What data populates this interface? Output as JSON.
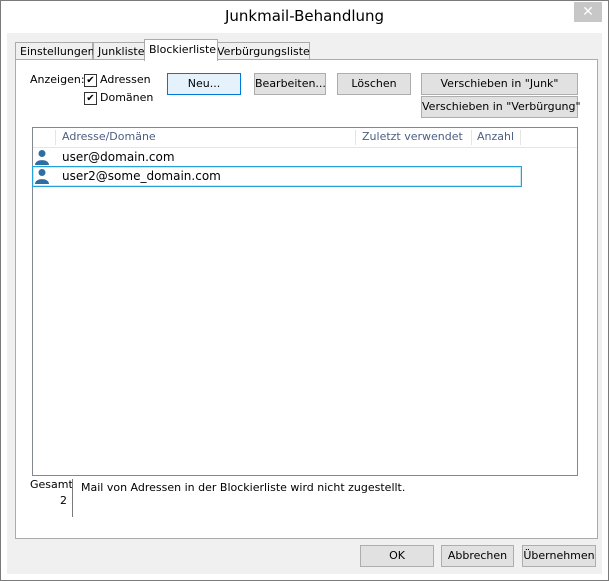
{
  "window": {
    "title": "Junkmail-Behandlung",
    "close_glyph": "✕"
  },
  "tabs": [
    {
      "label": "Einstellungen"
    },
    {
      "label": "Junkliste"
    },
    {
      "label": "Blockierliste"
    },
    {
      "label": "Verbürgungsliste"
    }
  ],
  "filter": {
    "label": "Anzeigen:",
    "options": [
      {
        "label": "Adressen",
        "checked": true
      },
      {
        "label": "Domänen",
        "checked": true
      }
    ]
  },
  "actions": {
    "new": "Neu...",
    "edit": "Bearbeiten...",
    "delete": "Löschen",
    "move_junk": "Verschieben in \"Junk\"",
    "move_trusted": "Verschieben in \"Verbürgung\""
  },
  "list": {
    "columns": [
      "Adresse/Domäne",
      "Zuletzt verwendet",
      "Anzahl"
    ],
    "rows": [
      {
        "address": "user@domain.com",
        "icon": "user-icon",
        "selected": false
      },
      {
        "address": "user2@some_domain.com",
        "icon": "user-icon",
        "selected": true
      }
    ]
  },
  "summary": {
    "total_label": "Gesamt",
    "total_value": "2",
    "note": "Mail von Adressen in der Blockierliste wird nicht zugestellt."
  },
  "footer": {
    "ok": "OK",
    "cancel": "Abbrechen",
    "apply": "Übernehmen"
  },
  "colors": {
    "accent": "#0078d7",
    "icon": "#2f6ea3",
    "selection_border": "#26a0da"
  }
}
